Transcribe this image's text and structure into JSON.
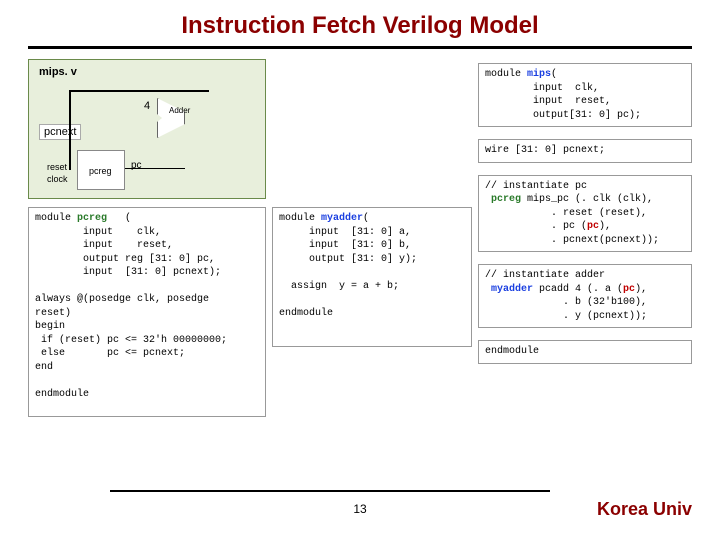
{
  "title": "Instruction Fetch Verilog Model",
  "diagram": {
    "file": "mips. v",
    "pcnext": "pcnext",
    "four": "4",
    "adder": "Adder",
    "reset": "reset",
    "clock": "clock",
    "pcreg": "pcreg",
    "pc": "pc"
  },
  "code_pcreg": {
    "l1a": "module ",
    "l1b": "pcreg",
    "l1c": "   (",
    "l2": "        input    clk,",
    "l3": "        input    reset,",
    "l4": "        output reg [31: 0] pc,",
    "l5": "        input  [31: 0] pcnext);",
    "blank": " ",
    "l6": "always @(posedge clk, posedge",
    "l7": "reset)",
    "l8": "begin",
    "l9": " if (reset) pc <= 32'h 00000000;",
    "l10": " else       pc <= pcnext;",
    "l11": "end",
    "l12": "endmodule"
  },
  "code_myadder": {
    "l1a": "module ",
    "l1b": "myadder",
    "l1c": "(",
    "l2": "     input  [31: 0] a,",
    "l3": "     input  [31: 0] b,",
    "l4": "     output [31: 0] y);",
    "blank": " ",
    "l5": "  assign  y = a + b;",
    "l6": "endmodule"
  },
  "code_mips": {
    "l1a": "module ",
    "l1b": "mips",
    "l1c": "(",
    "l2": "        input  clk,",
    "l3": "        input  reset,",
    "l4": "        output[31: 0] pc);"
  },
  "code_wire": "wire [31: 0] pcnext;",
  "code_inst_pc": {
    "c1": "// instantiate pc",
    "l1a": " ",
    "l1b": "pcreg",
    "l1c": " mips_pc (. clk (clk),",
    "l2": "           . reset (reset),",
    "l3a": "           . pc (",
    "l3b": "pc",
    "l3c": "),",
    "l4": "           . pcnext(pcnext));"
  },
  "code_inst_adder": {
    "c1": "// instantiate adder",
    "l1a": " ",
    "l1b": "myadder",
    "l1c": " pcadd 4 (. a (",
    "l1d": "pc",
    "l1e": "),",
    "l2": "             . b (32'b100),",
    "l3": "             . y (pcnext));"
  },
  "code_end": "endmodule",
  "page": "13",
  "footer": "Korea Univ"
}
